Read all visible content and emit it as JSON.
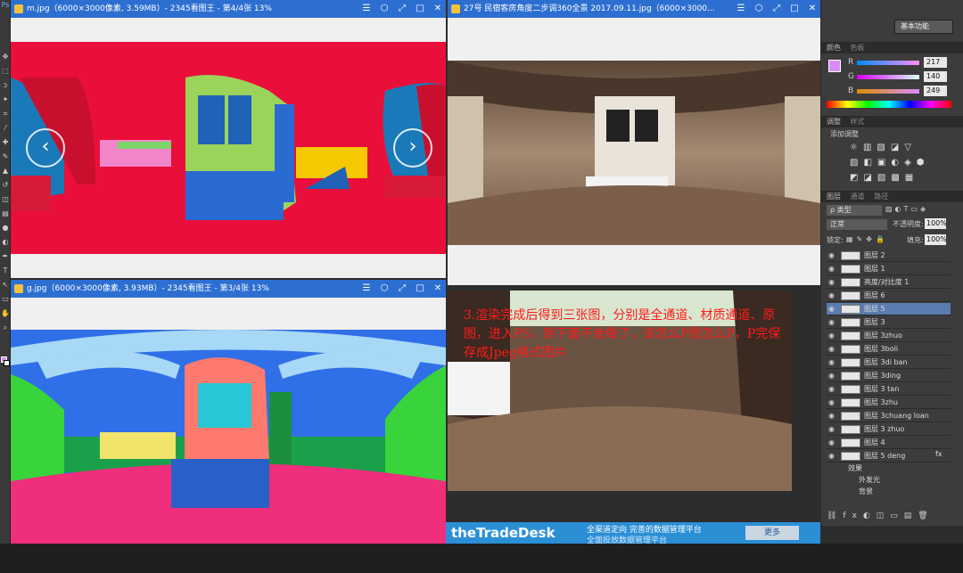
{
  "ps_menu_label": "基本功能",
  "windows": {
    "m": {
      "title": "m.jpg（6000×3000像素, 3.59MB）- 2345看图王 - 第4/4张 13%"
    },
    "pano": {
      "title": "27号 民宿客房角度二步调360全景 2017.09.11.jpg（6000×3000..."
    },
    "g": {
      "title": "g.jpg（6000×3000像素, 3.93MB）- 2345看图王 - 第3/4张 13%"
    }
  },
  "window_buttons": [
    "☰",
    "⬡",
    "⤢",
    "□",
    "✕"
  ],
  "nav": {
    "prev": "‹",
    "next": "›"
  },
  "annotation": "3.渲染完成后得到三张图，分别是全通道、材质通道、原图，进入PS，到下面不会做了，该怎么P图怎么P，P完保存成Jpeg格式图片",
  "color_panel": {
    "tab_color": "颜色",
    "tab_swatches": "色板",
    "R": {
      "label": "R",
      "value": "217"
    },
    "G": {
      "label": "G",
      "value": "140"
    },
    "B": {
      "label": "B",
      "value": "249"
    },
    "swatch": "#d98cf9"
  },
  "adjust_panel": {
    "tab1": "调整",
    "tab2": "样式",
    "title": "添加调整"
  },
  "layers_panel": {
    "tab1": "图层",
    "tab2": "通道",
    "tab3": "路径",
    "filter": "ρ 类型",
    "blend": "正常",
    "opacity_label": "不透明度:",
    "opacity": "100%",
    "lock_label": "锁定:",
    "fill_label": "填充:",
    "fill": "100%",
    "layers": [
      {
        "name": "图层 2",
        "selected": false
      },
      {
        "name": "图层 1",
        "selected": false
      },
      {
        "name": "亮度/对比度 1",
        "selected": false
      },
      {
        "name": "图层 6",
        "selected": false
      },
      {
        "name": "图层 5",
        "selected": true
      },
      {
        "name": "图层 3",
        "selected": false
      },
      {
        "name": "图层 3zhuo",
        "selected": false
      },
      {
        "name": "图层 3boli",
        "selected": false
      },
      {
        "name": "图层 3di ban",
        "selected": false
      },
      {
        "name": "图层 3ding",
        "selected": false
      },
      {
        "name": "图层 3 tan",
        "selected": false
      },
      {
        "name": "图层 3zhu",
        "selected": false
      },
      {
        "name": "图层 3chuang loan",
        "selected": false
      },
      {
        "name": "图层 3 zhuo",
        "selected": false
      },
      {
        "name": "图层 4",
        "selected": false
      },
      {
        "name": "图层 5 deng",
        "selected": false
      }
    ],
    "effects": "效果",
    "outer_glow": "外发光",
    "background": "背景",
    "fx": "fx"
  },
  "ad": {
    "brand": "theTradeDesk",
    "line1": "全渠道定向 完善的数据管理平台",
    "line2": "全面投放数据管理平台",
    "more": "更多"
  }
}
